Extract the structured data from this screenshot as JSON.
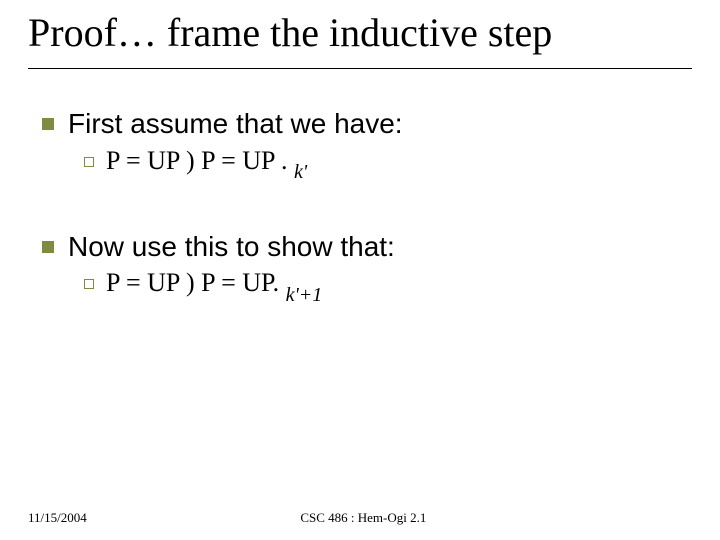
{
  "title": "Proof… frame the inductive step",
  "points": [
    {
      "text": "First assume that we have:",
      "sub": {
        "lhs": "P  = UP ",
        "symbol": ")",
        "rhs": " P  = UP ",
        "trail": ". ",
        "subscript": "k'"
      }
    },
    {
      "text": "Now use this to show that:",
      "sub": {
        "lhs": "P  = UP ",
        "symbol": ")",
        "rhs": " P  = UP",
        "trail": ". ",
        "subscript": "k'+1"
      }
    }
  ],
  "footer": {
    "date": "11/15/2004",
    "center": "CSC 486 : Hem-Ogi 2.1"
  }
}
